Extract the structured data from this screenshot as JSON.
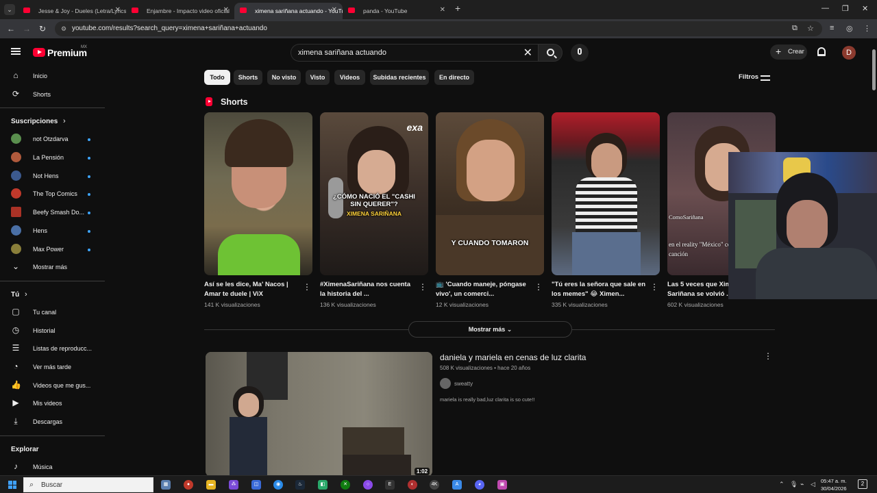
{
  "browser": {
    "tabs": [
      {
        "label": "Jesse & Joy - Dueles (Letra/Lyrics",
        "active": false
      },
      {
        "label": "Enjambre - Impacto video oficial",
        "active": false
      },
      {
        "label": "ximena sariñana actuando - YouTube",
        "active": true
      },
      {
        "label": "panda - YouTube",
        "active": false
      }
    ],
    "url": "youtube.com/results?search_query=ximena+sariñana+actuando"
  },
  "header": {
    "logo_text": "Premium",
    "logo_region": "MX",
    "search_query": "ximena sariñana actuando",
    "create_label": "Crear",
    "avatar_letter": "D"
  },
  "sidebar": {
    "main": [
      {
        "label": "Inicio",
        "icon": "home-icon"
      },
      {
        "label": "Shorts",
        "icon": "shorts-icon"
      }
    ],
    "subscriptions_title": "Suscripciones",
    "subscriptions": [
      {
        "label": "not Otzdarva",
        "color": "#5a8f4e"
      },
      {
        "label": "La Pensión",
        "color": "#b05a3c"
      },
      {
        "label": "Not Hens",
        "color": "#3c5a8f"
      },
      {
        "label": "The Top Comics",
        "color": "#c0392b"
      },
      {
        "label": "Beefy Smash Do...",
        "color": "#a93226"
      },
      {
        "label": "Hens",
        "color": "#4a6fa5"
      },
      {
        "label": "Max Power",
        "color": "#8a7f3a"
      }
    ],
    "show_more": "Mostrar más",
    "you_title": "Tú",
    "you_items": [
      {
        "label": "Tu canal",
        "icon": "channel-icon"
      },
      {
        "label": "Historial",
        "icon": "history-icon"
      },
      {
        "label": "Listas de reproducc...",
        "icon": "playlists-icon"
      },
      {
        "label": "Ver más tarde",
        "icon": "watch-later-icon"
      },
      {
        "label": "Videos que me gus...",
        "icon": "like-icon"
      },
      {
        "label": "Mis videos",
        "icon": "my-videos-icon"
      },
      {
        "label": "Descargas",
        "icon": "download-icon"
      }
    ],
    "explore_title": "Explorar",
    "explore_first": "Música"
  },
  "chips": [
    "Todo",
    "Shorts",
    "No visto",
    "Visto",
    "Videos",
    "Subidas recientes",
    "En directo"
  ],
  "filters_label": "Filtros",
  "shorts": {
    "title": "Shorts",
    "items": [
      {
        "title": "Así se les dice, Ma' Nacos | Amar te duele | ViX",
        "views": "141 K visualizaciones"
      },
      {
        "title": "#XimenaSariñana nos cuenta la historia del ...",
        "views": "136 K visualizaciones",
        "overlay": "¿CÓMO NACIÓ EL \"CASHI SIN QUERER\"?",
        "overlay2": "XIMENA SARIÑANA",
        "badge": "exa"
      },
      {
        "title": "📺 'Cuando maneje, póngase vivo', un comerci...",
        "views": "12 K visualizaciones",
        "overlay": "Y CUANDO TOMARON"
      },
      {
        "title": "\"Tú eres la señora que sale en los memes\" 😂 Ximen...",
        "views": "335 K visualizaciones"
      },
      {
        "title": "Las 5 veces que Ximena Sariñana se volvió ...",
        "views": "602 K visualizaciones",
        "overlay": "ComoSariñana",
        "overlay2": "en el reality \"México\" conmovió con la canción"
      }
    ],
    "show_more": "Mostrar más"
  },
  "video": {
    "title": "daniela y mariela en cenas de luz clarita",
    "meta": "508 K visualizaciones • hace 20 años",
    "channel": "sweatty",
    "description": "mariela is really bad,luz clarita is so cute!!",
    "duration": "1:02"
  },
  "taskbar": {
    "search_label": "Buscar",
    "time": "05:47 a. m.",
    "date": "30/04/2026",
    "notification_count": "2"
  }
}
